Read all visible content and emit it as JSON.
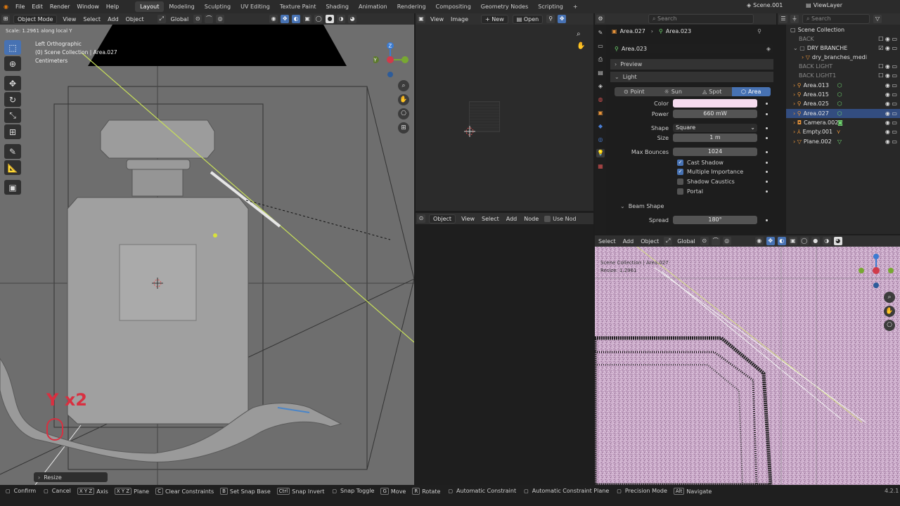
{
  "topbar": {
    "menus": [
      "File",
      "Edit",
      "Render",
      "Window",
      "Help"
    ],
    "workspaces": [
      "Layout",
      "Modeling",
      "Sculpting",
      "UV Editing",
      "Texture Paint",
      "Shading",
      "Animation",
      "Rendering",
      "Compositing",
      "Geometry Nodes",
      "Scripting"
    ],
    "active_workspace": "Layout",
    "add_tab": "+",
    "scene": "Scene.001",
    "view_layer": "ViewLayer"
  },
  "viewport3d": {
    "mode": "Object Mode",
    "menus": [
      "View",
      "Select",
      "Add",
      "Object"
    ],
    "transform_orientation": "Global",
    "operator_status": "Scale: 1.2961 along local Y",
    "overlay_lines": [
      "Left Orthographic",
      "(0) Scene Collection | Area.027",
      "Centimeters"
    ],
    "key_hint": "Y x2",
    "last_op_panel": "Resize",
    "gizmo_axes": [
      "Z",
      "Y"
    ]
  },
  "image_editor": {
    "menus": [
      "View",
      "Image"
    ],
    "new_label": "New",
    "open_label": "Open"
  },
  "node_editor": {
    "type": "Object",
    "menus": [
      "View",
      "Select",
      "Add",
      "Node"
    ],
    "use_nodes": "Use Nod"
  },
  "render_viewport": {
    "menus": [
      "Select",
      "Add",
      "Object"
    ],
    "orientation": "Global",
    "overlay_lines": [
      "Scene Collection | Area.027",
      "Resize: 1.2961"
    ]
  },
  "properties": {
    "search_placeholder": "Search",
    "breadcrumb": [
      "Area.027",
      "Area.023"
    ],
    "datablock": "Area.023",
    "preview_label": "Preview",
    "light_label": "Light",
    "light_types": [
      "Point",
      "Sun",
      "Spot",
      "Area"
    ],
    "active_type": "Area",
    "fields": {
      "color_label": "Color",
      "color_value": "#f6dcef",
      "power_label": "Power",
      "power_value": "660 mW",
      "shape_label": "Shape",
      "shape_value": "Square",
      "size_label": "Size",
      "size_value": "1 m",
      "bounces_label": "Max Bounces",
      "bounces_value": "1024",
      "spread_label": "Spread",
      "spread_value": "180°"
    },
    "checkboxes": [
      {
        "label": "Cast Shadow",
        "checked": true
      },
      {
        "label": "Multiple Importance",
        "checked": true
      },
      {
        "label": "Shadow Caustics",
        "checked": false
      },
      {
        "label": "Portal",
        "checked": false
      }
    ],
    "beam_shape_label": "Beam Shape"
  },
  "outliner": {
    "search_placeholder": "Search",
    "root": "Scene Collection",
    "items": [
      {
        "name": "BACK",
        "dim": true
      },
      {
        "name": "DRY BRANCHE",
        "dim": false
      },
      {
        "name": "dry_branches_medi",
        "dim": false
      },
      {
        "name": "BACK LIGHT",
        "dim": true
      },
      {
        "name": "BACK LIGHT1",
        "dim": true
      },
      {
        "name": "Area.013",
        "dim": false
      },
      {
        "name": "Area.015",
        "dim": false
      },
      {
        "name": "Area.025",
        "dim": false
      },
      {
        "name": "Area.027",
        "dim": false
      },
      {
        "name": "Camera.002",
        "dim": false
      },
      {
        "name": "Empty.001",
        "dim": false
      },
      {
        "name": "Plane.002",
        "dim": false
      }
    ]
  },
  "statusbar": {
    "items": [
      {
        "key": "",
        "label": "Confirm"
      },
      {
        "key": "",
        "label": "Cancel"
      },
      {
        "key": "X Y Z",
        "label": "Axis"
      },
      {
        "key": "X Y Z",
        "label": "Plane"
      },
      {
        "key": "C",
        "label": "Clear Constraints"
      },
      {
        "key": "B",
        "label": "Set Snap Base"
      },
      {
        "key": "Ctrl",
        "label": "Snap Invert"
      },
      {
        "key": "",
        "label": "Snap Toggle"
      },
      {
        "key": "G",
        "label": "Move"
      },
      {
        "key": "R",
        "label": "Rotate"
      },
      {
        "key": "",
        "label": "Automatic Constraint"
      },
      {
        "key": "",
        "label": "Automatic Constraint Plane"
      },
      {
        "key": "",
        "label": "Precision Mode"
      },
      {
        "key": "Alt",
        "label": "Navigate"
      }
    ],
    "version": "4.2.1"
  },
  "colors": {
    "accent": "#4772b3",
    "light_color": "#f6dcef",
    "render_noise": "#c9a8c8"
  }
}
